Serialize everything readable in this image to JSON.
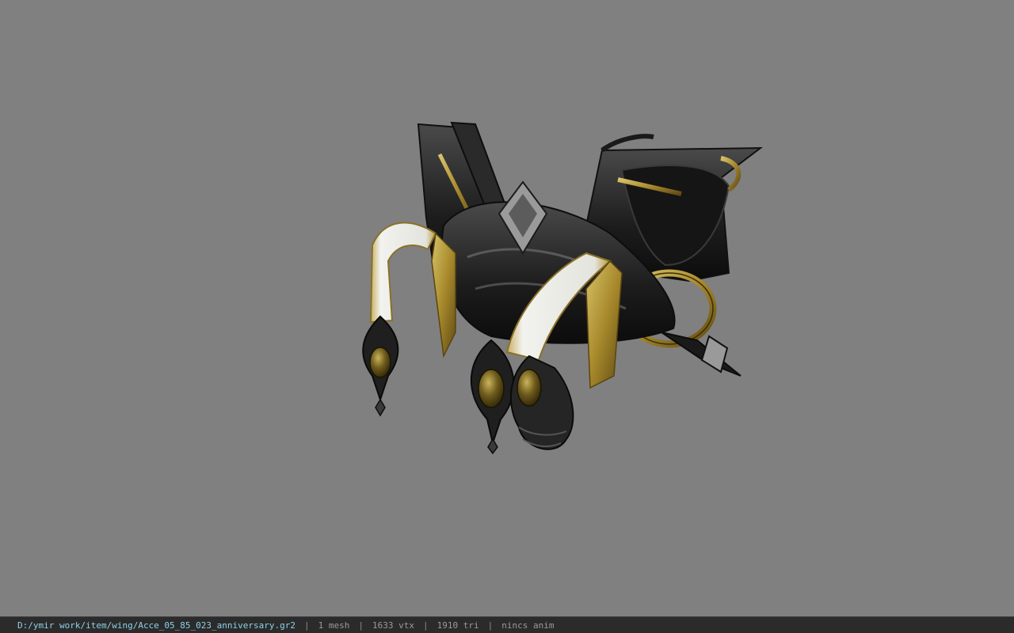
{
  "viewer": {
    "background_color": "#808080",
    "model_name": "Acce_05_85_023_anniversary"
  },
  "status": {
    "file_path": "D:/ymir work/item/wing/Acce_05_85_023_anniversary.gr2",
    "separator": "|",
    "mesh_count": "1 mesh",
    "vertex_count": "1633 vtx",
    "triangle_count": "1910 tri",
    "anim": "nincs anim",
    "path_color": "#8fd0e8"
  }
}
